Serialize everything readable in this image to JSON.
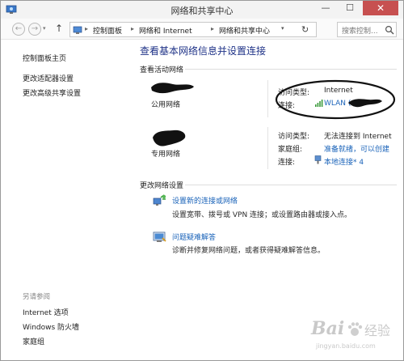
{
  "window": {
    "title": "网络和共享中心",
    "minimize": "—",
    "maximize": "☐",
    "close": "✕"
  },
  "nav": {
    "back": "←",
    "forward": "→",
    "history": "▾",
    "up": "↑",
    "breadcrumbs": [
      "控制面板",
      "网络和 Internet",
      "网络和共享中心"
    ],
    "separator": "▸",
    "address_dropdown": "▾",
    "refresh": "↻",
    "search_placeholder": "搜索控制..."
  },
  "sidebar": {
    "items": [
      {
        "label": "控制面板主页"
      },
      {
        "label": "更改适配器设置"
      },
      {
        "label": "更改高级共享设置"
      }
    ],
    "see_also_heading": "另请参阅",
    "see_also": [
      {
        "label": "Internet 选项"
      },
      {
        "label": "Windows 防火墙"
      },
      {
        "label": "家庭组"
      }
    ]
  },
  "main": {
    "title": "查看基本网络信息并设置连接",
    "active_networks_heading": "查看活动网络",
    "networks": [
      {
        "type": "公用网络",
        "access_label": "访问类型:",
        "access_value": "Internet",
        "connection_label": "连接:",
        "connection_value": "WLAN ("
      },
      {
        "type": "专用网络",
        "access_label": "访问类型:",
        "access_value": "无法连接到 Internet",
        "homegroup_label": "家庭组:",
        "homegroup_value": "准备就绪，可以创建",
        "connection_label": "连接:",
        "connection_value": "本地连接* 4"
      }
    ],
    "change_settings_heading": "更改网络设置",
    "tasks": [
      {
        "link": "设置新的连接或网络",
        "description": "设置宽带、拨号或 VPN 连接；或设置路由器或接入点。",
        "icon": "new-connection-icon"
      },
      {
        "link": "问题疑难解答",
        "description": "诊断并修复网络问题，或者获得疑难解答信息。",
        "icon": "troubleshoot-icon"
      }
    ]
  },
  "watermark": {
    "brand": "Bai",
    "brand2": "经验",
    "site": "jingyan.baidu.com"
  },
  "colors": {
    "link": "#1a63b9",
    "title": "#1e3287",
    "close_button": "#c75050"
  }
}
